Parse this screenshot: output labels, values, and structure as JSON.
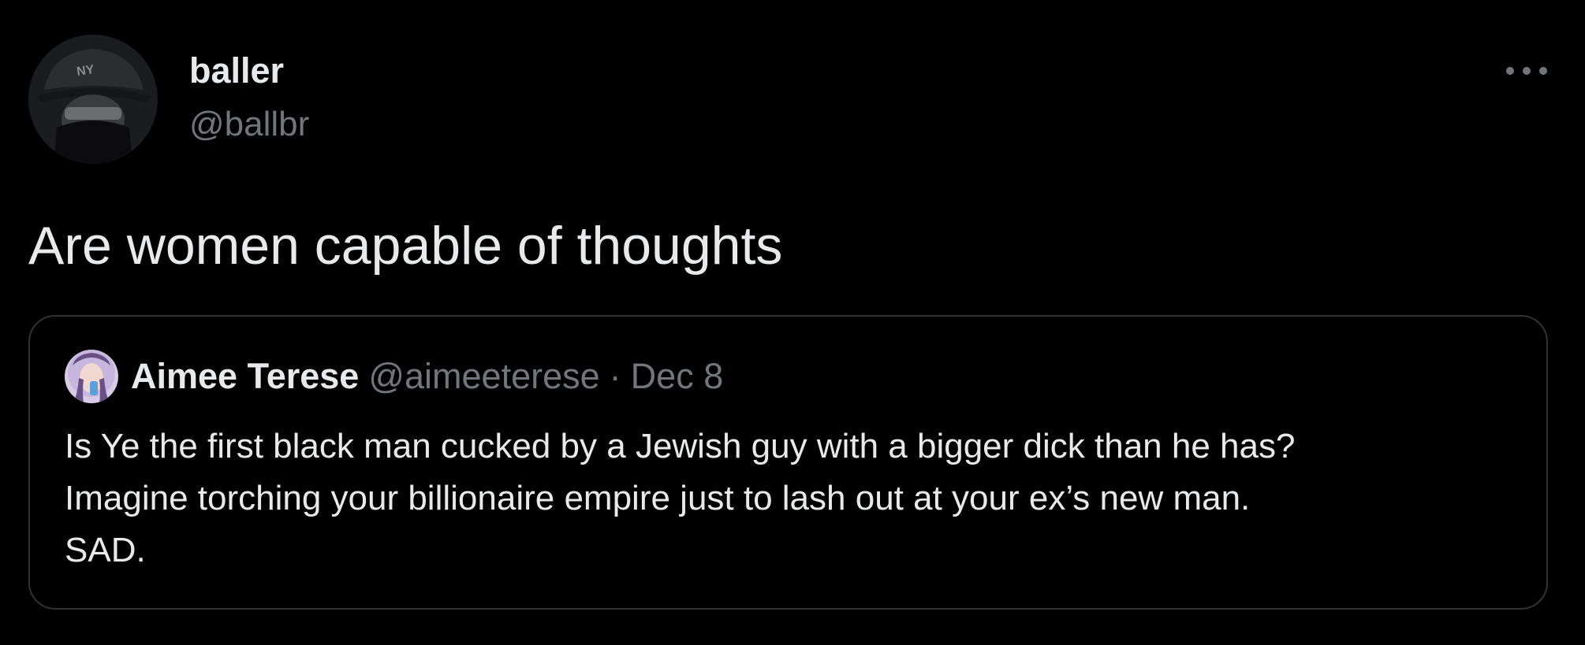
{
  "tweet": {
    "author": {
      "display_name": "baller",
      "handle": "@ballbr",
      "avatar_icon": "avatar-photo"
    },
    "more_icon": "more-options-icon",
    "text": "Are women capable of thoughts",
    "quoted": {
      "display_name": "Aimee Terese",
      "handle": "@aimeeterese",
      "separator": "·",
      "date": "Dec 8",
      "avatar_icon": "avatar-photo",
      "text_lines": [
        "Is Ye the first black man cucked by a Jewish guy with a bigger dick than he has?",
        "Imagine torching your billionaire empire just to lash out at your ex’s new man.",
        "SAD."
      ]
    }
  },
  "colors": {
    "background": "#000000",
    "primary_text": "#e7e9ea",
    "secondary_text": "#71767b",
    "border": "#2f3336"
  }
}
